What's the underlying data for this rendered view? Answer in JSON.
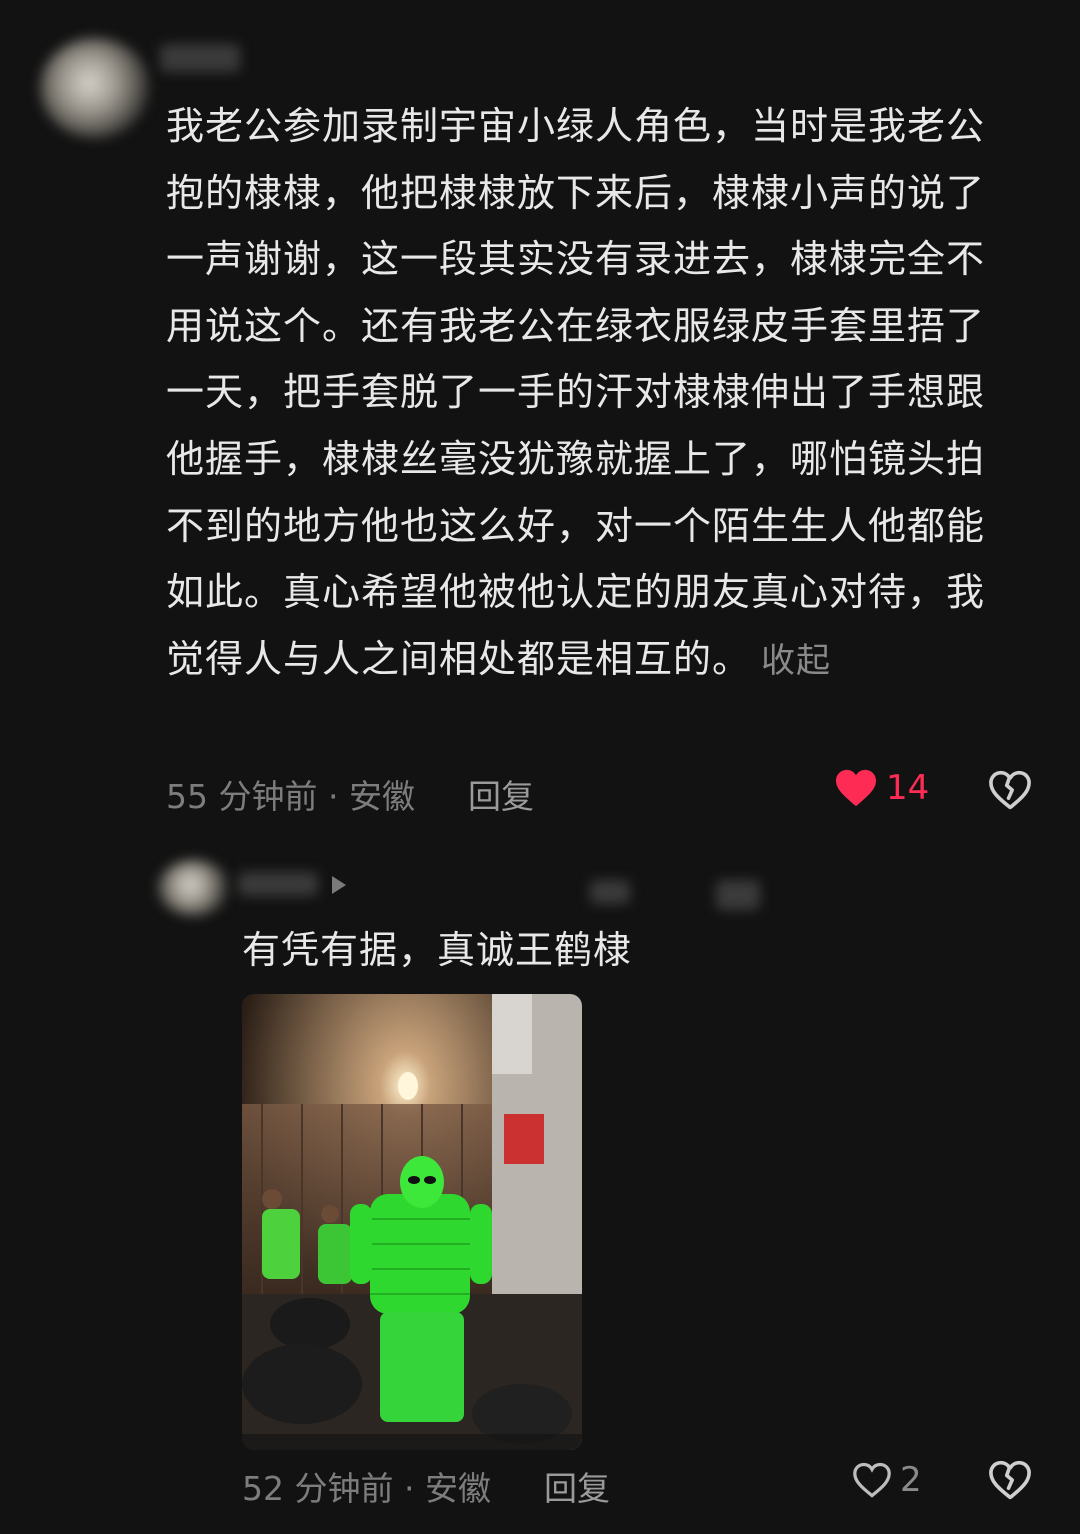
{
  "comments": [
    {
      "text": "我老公参加录制宇宙小绿人角色，当时是我老公抱的棣棣，他把棣棣放下来后，棣棣小声的说了一声谢谢，这一段其实没有录进去，棣棣完全不用说这个。还有我老公在绿衣服绿皮手套里捂了一天，把手套脱了一手的汗对棣棣伸出了手想跟他握手，棣棣丝毫没犹豫就握上了，哪怕镜头拍不到的地方他也这么好，对一个陌生生人他都能如此。真心希望他被他认定的朋友真心对待，我觉得人与人之间相处都是相互的。",
      "collapse_label": "收起",
      "time_location": "55 分钟前 · 安徽",
      "reply_label": "回复",
      "like_count": "14",
      "liked": true
    },
    {
      "text": "有凭有据，真诚王鹤棣",
      "time_location": "52 分钟前 · 安徽",
      "reply_label": "回复",
      "like_count": "2",
      "liked": false
    }
  ],
  "colors": {
    "background": "#121212",
    "like_active": "#fe2c55",
    "muted_text": "#7d7d7d"
  },
  "icons": {
    "like": "heart-icon",
    "dislike": "broken-heart-icon",
    "reply_target": "play-arrow-icon"
  }
}
